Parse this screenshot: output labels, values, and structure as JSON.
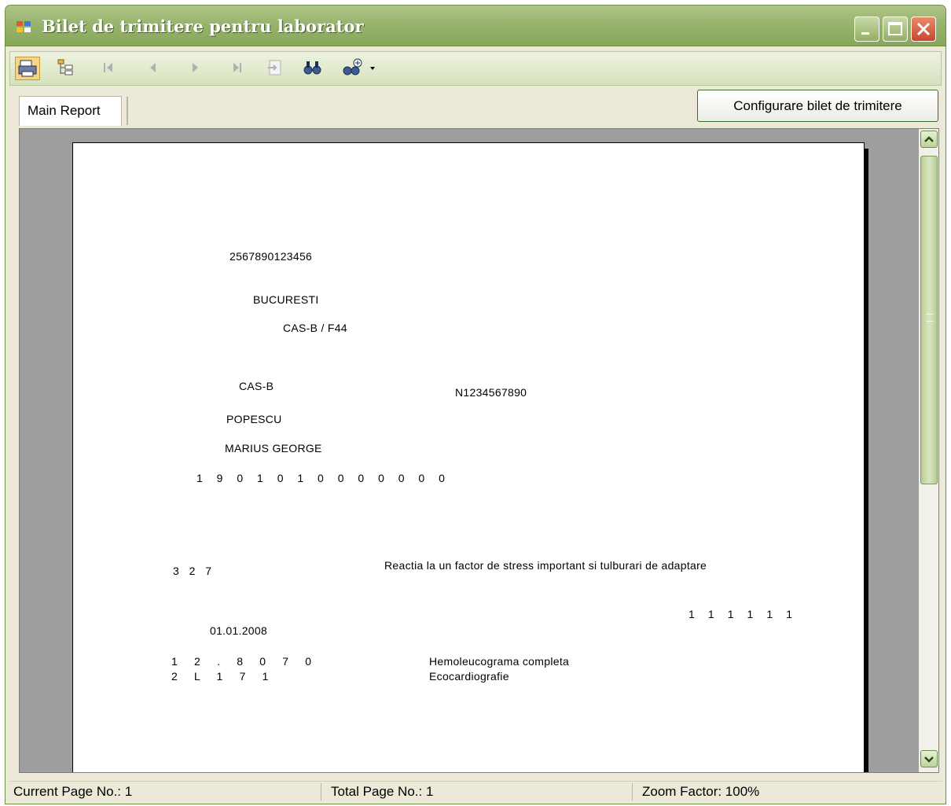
{
  "window": {
    "title": "Bilet de trimitere pentru laborator"
  },
  "toolbar": {
    "buttons": [
      "print-icon",
      "toggle-tree-icon",
      "first-page-icon",
      "previous-page-icon",
      "next-page-icon",
      "last-page-icon",
      "goto-page-icon",
      "find-icon",
      "zoom-icon"
    ]
  },
  "tabs": {
    "main_report": "Main Report"
  },
  "actions": {
    "configure": "Configurare bilet de trimitere"
  },
  "report": {
    "cnp_top": "2567890123456",
    "city": "BUCURESTI",
    "cas_code": "CAS-B / F44",
    "insurer": "CAS-B",
    "doc_number": "N1234567890",
    "last_name": "POPESCU",
    "first_name": "MARIUS GEORGE",
    "cnp_spaced": "1 9 0 1 0 1 0 0 0 0 0 0 0",
    "diag_code": "3   2   7",
    "diagnosis": "Reactia la un factor de stress important si tulburari de adaptare",
    "checkboxes": "1    1    1    1    1    1",
    "date": "01.01.2008",
    "analyses": [
      {
        "code": "1     2     .     8     0     7     0",
        "name": "Hemoleucograma completa"
      },
      {
        "code": "2     L     1     7     1",
        "name": "Ecocardiografie"
      }
    ]
  },
  "status": {
    "current_page": "Current Page No.: 1",
    "total_pages": "Total Page No.: 1",
    "zoom": "Zoom Factor: 100%"
  }
}
